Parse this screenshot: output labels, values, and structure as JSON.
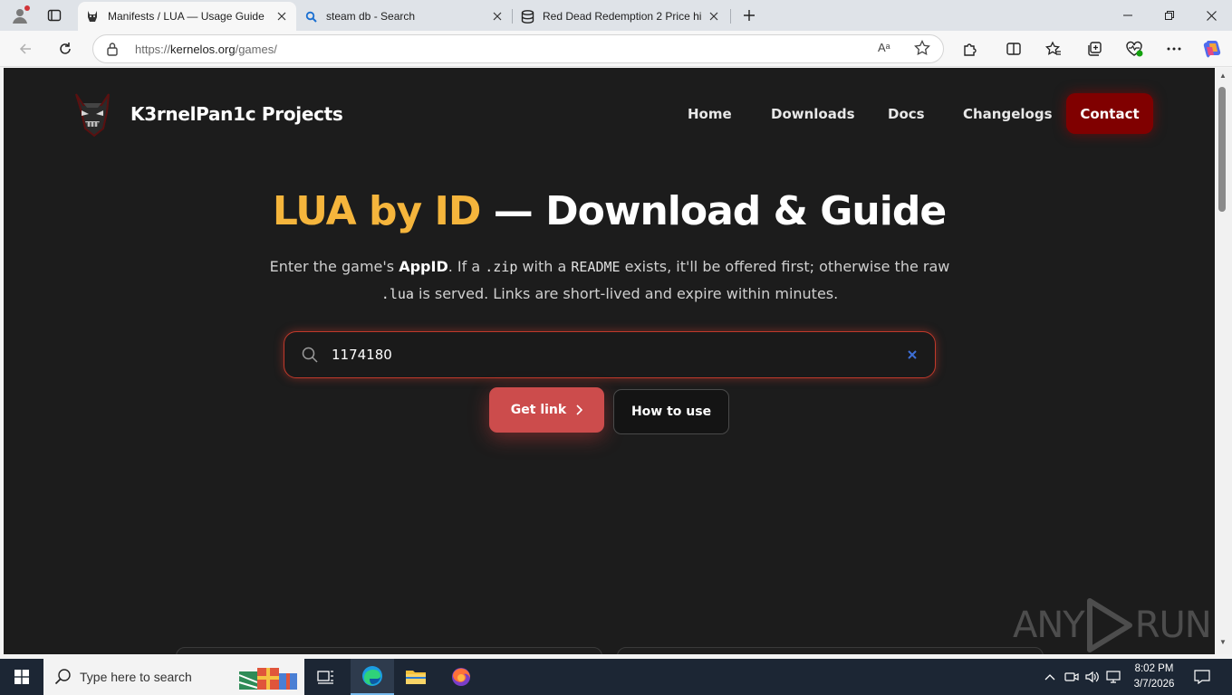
{
  "browser": {
    "tabs": [
      {
        "title": "Manifests / LUA — Usage Guide",
        "active": true,
        "icon": "demon-mask-favicon"
      },
      {
        "title": "steam db - Search",
        "active": false,
        "icon": "search-favicon"
      },
      {
        "title": "Red Dead Redemption 2 Price his",
        "active": false,
        "icon": "database-favicon"
      }
    ],
    "url_prefix": "https://",
    "url_host": "kernelos.org",
    "url_path": "/games/",
    "read_aloud_label": "Aᵃ"
  },
  "site": {
    "brand": "K3rnelPan1c Projects",
    "nav": [
      "Home",
      "Downloads",
      "Docs",
      "Changelogs"
    ],
    "contact": "Contact"
  },
  "hero": {
    "title_accent": "LUA by ID",
    "title_rest": " — Download & Guide",
    "desc_parts": {
      "p1": "Enter the game's ",
      "appid": "AppID",
      "p2": ". If a ",
      "zip": ".zip",
      "p3": " with a ",
      "readme": "README",
      "p4": " exists, it'll be offered first; otherwise the raw ",
      "lua": ".lua",
      "p5": " is served. Links are short-lived and expire within minutes."
    }
  },
  "search": {
    "value": "1174180"
  },
  "actions": {
    "get_link": "Get link",
    "how_to": "How to use"
  },
  "watermark": {
    "left": "ANY",
    "right": "RUN"
  },
  "taskbar": {
    "search_placeholder": "Type here to search",
    "time": "8:02 PM",
    "date": "3/7/2026"
  },
  "colors": {
    "accent_gold": "#f5b53c",
    "brand_red": "#800000",
    "button_red": "#cc4c4c",
    "page_bg": "#1c1c1c"
  }
}
